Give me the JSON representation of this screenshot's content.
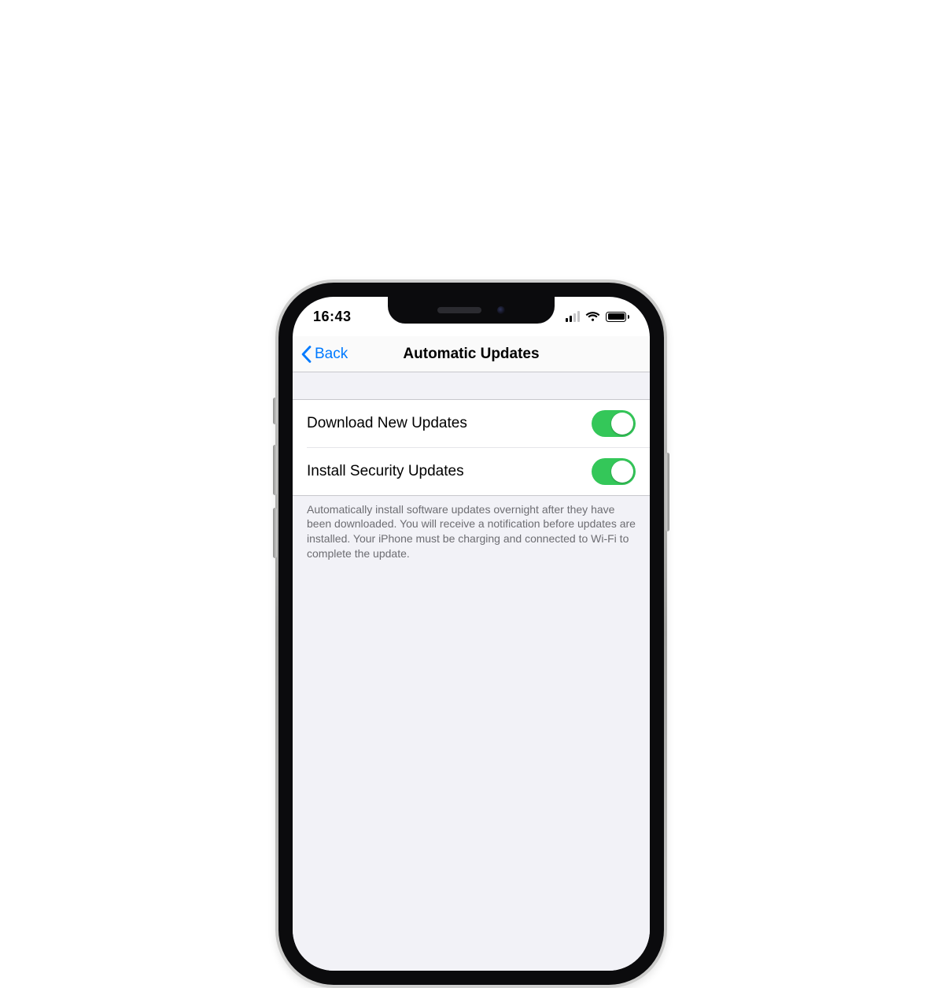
{
  "status_bar": {
    "time": "16:43",
    "signal_active_bars": 2,
    "signal_total_bars": 4,
    "battery_level": 1.0
  },
  "nav": {
    "back_label": "Back",
    "title": "Automatic Updates"
  },
  "settings": {
    "rows": [
      {
        "label": "Download New Updates",
        "on": true
      },
      {
        "label": "Install Security Updates",
        "on": true
      }
    ],
    "footer": "Automatically install software updates overnight after they have been downloaded. You will receive a notification before updates are installed. Your iPhone must be charging and connected to Wi‑Fi to complete the update."
  },
  "colors": {
    "ios_blue": "#007aff",
    "switch_green": "#34c759",
    "grouped_bg": "#f2f2f7"
  }
}
